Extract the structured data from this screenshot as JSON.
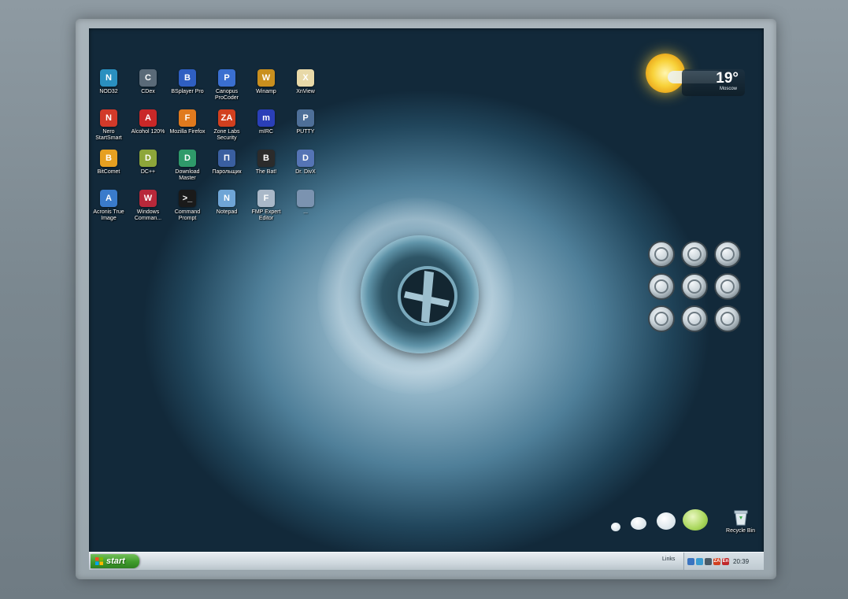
{
  "desktop": {
    "icons": [
      {
        "label": "NOD32",
        "icon": "nod32-icon",
        "color": "#2a8fbf",
        "glyph": "N"
      },
      {
        "label": "CDex",
        "icon": "cdex-icon",
        "color": "#5a6a78",
        "glyph": "C"
      },
      {
        "label": "BSplayer Pro",
        "icon": "bsplayer-icon",
        "color": "#2f5fc2",
        "glyph": "B"
      },
      {
        "label": "Canopus ProCoder",
        "icon": "procoder-icon",
        "color": "#3a6fd0",
        "glyph": "P"
      },
      {
        "label": "Winamp",
        "icon": "winamp-icon",
        "color": "#c98f1e",
        "glyph": "W"
      },
      {
        "label": "XnView",
        "icon": "xnview-icon",
        "color": "#e8d9a8",
        "glyph": "X"
      },
      {
        "label": "Nero StartSmart",
        "icon": "nero-icon",
        "color": "#d23a2a",
        "glyph": "N"
      },
      {
        "label": "Alcohol 120%",
        "icon": "alcohol-icon",
        "color": "#c92828",
        "glyph": "A"
      },
      {
        "label": "Mozilla Firefox",
        "icon": "firefox-icon",
        "color": "#e07a1e",
        "glyph": "F"
      },
      {
        "label": "Zone Labs Security",
        "icon": "zonealarm-icon",
        "color": "#d2401f",
        "glyph": "ZA"
      },
      {
        "label": "mIRC",
        "icon": "mirc-icon",
        "color": "#2a3fb8",
        "glyph": "m"
      },
      {
        "label": "PUTTY",
        "icon": "putty-icon",
        "color": "#4e6f98",
        "glyph": "P"
      },
      {
        "label": "BitComet",
        "icon": "bitcomet-icon",
        "color": "#e6a021",
        "glyph": "B"
      },
      {
        "label": "DC++",
        "icon": "dcpp-icon",
        "color": "#8da63a",
        "glyph": "D"
      },
      {
        "label": "Download Master",
        "icon": "download-master-icon",
        "color": "#2f9a6a",
        "glyph": "D"
      },
      {
        "label": "Парольщик",
        "icon": "password-manager-icon",
        "color": "#3a5fa0",
        "glyph": "П"
      },
      {
        "label": "The Bat!",
        "icon": "thebat-icon",
        "color": "#2b2b2b",
        "glyph": "B"
      },
      {
        "label": "Dr. DivX",
        "icon": "drdivx-icon",
        "color": "#5574b5",
        "glyph": "D"
      },
      {
        "label": "Acronis True Image",
        "icon": "acronis-icon",
        "color": "#3a7bcb",
        "glyph": "A"
      },
      {
        "label": "Windows Comman...",
        "icon": "total-commander-icon",
        "color": "#b8283a",
        "glyph": "W"
      },
      {
        "label": "Command Prompt",
        "icon": "command-prompt-icon",
        "color": "#1a1a1a",
        "glyph": ">_"
      },
      {
        "label": "Notepad",
        "icon": "notepad-icon",
        "color": "#6fa5d6",
        "glyph": "N"
      },
      {
        "label": "FMP Expert Editor",
        "icon": "fmp-editor-icon",
        "color": "#a9b8c8",
        "glyph": "F"
      },
      {
        "label": "...",
        "icon": "unknown-app-icon",
        "color": "#7b93b0",
        "glyph": ""
      }
    ]
  },
  "weather": {
    "temperature": "19°",
    "city": "Moscow",
    "condition_icon": "sun-cloud-icon"
  },
  "button_gadget": {
    "buttons": [
      "btn-1",
      "btn-2",
      "btn-3",
      "btn-4",
      "btn-5",
      "btn-6",
      "btn-7",
      "btn-8",
      "btn-9"
    ]
  },
  "recycle_bin": {
    "label": "Recycle Bin",
    "icon": "recycle-bin-icon"
  },
  "taskbar": {
    "start_label": "start",
    "links_label": "Links",
    "links_chevron": "»",
    "clock": "20:39",
    "tray_icons": [
      {
        "name": "network-icon",
        "color": "#3a74c0",
        "glyph": ""
      },
      {
        "name": "globe-icon",
        "color": "#3a9bd0",
        "glyph": ""
      },
      {
        "name": "display-icon",
        "color": "#4a5a66",
        "glyph": ""
      },
      {
        "name": "zonealarm-tray-icon",
        "color": "#d2401f",
        "glyph": "ZA"
      },
      {
        "name": "language-icon",
        "color": "#c0282a",
        "glyph": "En"
      }
    ]
  },
  "colors": {
    "start_green": "#3f9b2c",
    "bubble_green": "#a8d65a"
  }
}
